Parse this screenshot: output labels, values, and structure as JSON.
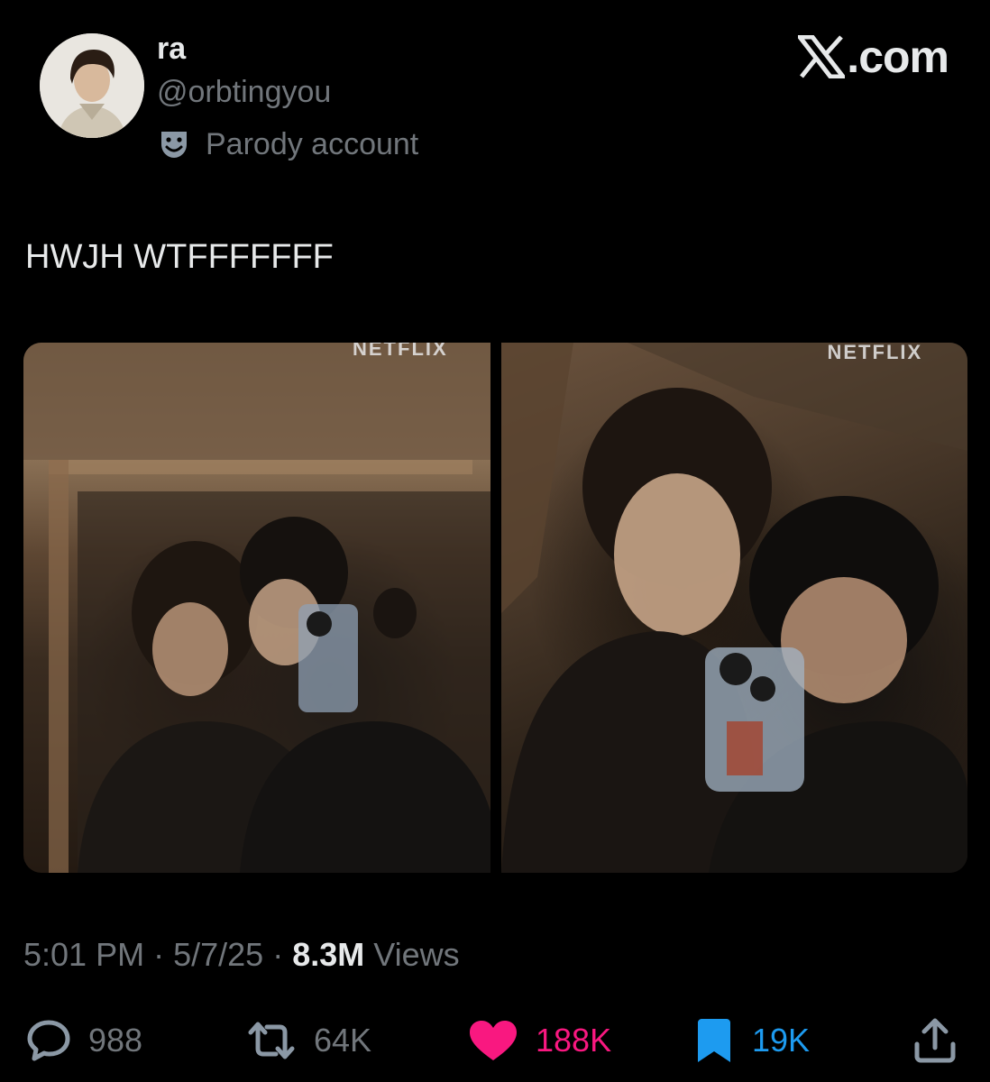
{
  "header": {
    "display_name": "ra",
    "handle": "@orbtingyou",
    "parody_label": "Parody account",
    "site_logo": ".com"
  },
  "tweet": {
    "text": "HWJH WTFFFFFFF",
    "media": [
      {
        "watermark": "NETFLIX"
      },
      {
        "watermark": "NETFLIX"
      }
    ]
  },
  "meta": {
    "time": "5:01 PM",
    "date": "5/7/25",
    "views_count": "8.3M",
    "views_label": "Views"
  },
  "actions": {
    "reply_count": "988",
    "repost_count": "64K",
    "like_count": "188K",
    "bookmark_count": "19K"
  },
  "colors": {
    "background": "#000000",
    "text_primary": "#e7e9ea",
    "text_secondary": "#71767b",
    "like": "#f91880",
    "bookmark": "#1d9bf0"
  },
  "icons": {
    "parody": "theater-masks-icon",
    "reply": "speech-bubble-icon",
    "repost": "repost-arrows-icon",
    "like": "heart-filled-icon",
    "bookmark": "bookmark-filled-icon",
    "share": "share-upload-icon",
    "site": "x-logo-icon"
  }
}
